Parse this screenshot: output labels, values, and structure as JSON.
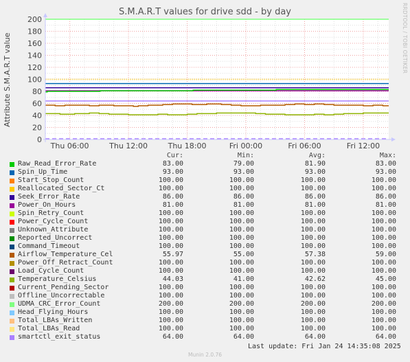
{
  "title": "S.M.A.R.T values for drive sdd - by day",
  "side_credit": "RRDTOOL / TOBI OETIKER",
  "footer": "Munin 2.0.76",
  "last_update": "Last update: Fri Jan 24 14:35:08 2025",
  "legend_headers": {
    "cur": "Cur:",
    "min": "Min:",
    "avg": "Avg:",
    "max": "Max:"
  },
  "chart_data": {
    "type": "line",
    "title": "S.M.A.R.T values for drive sdd - by day",
    "xlabel": "",
    "ylabel": "Attribute S.M.A.R.T value",
    "ylim": [
      0,
      200
    ],
    "yticks": [
      0,
      20,
      40,
      60,
      80,
      100,
      120,
      140,
      160,
      180,
      200
    ],
    "x_range_hours": [
      3.5,
      38.6
    ],
    "xticks": [
      {
        "label": "Thu 06:00",
        "hour": 6
      },
      {
        "label": "Thu 12:00",
        "hour": 12
      },
      {
        "label": "Thu 18:00",
        "hour": 18
      },
      {
        "label": "Fri 00:00",
        "hour": 24
      },
      {
        "label": "Fri 06:00",
        "hour": 30
      },
      {
        "label": "Fri 12:00",
        "hour": 36
      }
    ],
    "grid": true,
    "legend_position": "bottom",
    "series": [
      {
        "name": "Raw_Read_Error_Rate",
        "color": "#00cc00",
        "cur": "83.00",
        "min": "79.00",
        "avg": "81.90",
        "max": "83.00",
        "points": [
          [
            3.5,
            79
          ],
          [
            3.7,
            80
          ],
          [
            9,
            80
          ],
          [
            9.1,
            81
          ],
          [
            18.5,
            81
          ],
          [
            18.6,
            82
          ],
          [
            20.5,
            82
          ],
          [
            20.6,
            82
          ],
          [
            27,
            82
          ],
          [
            27.1,
            83
          ],
          [
            38.6,
            83
          ]
        ]
      },
      {
        "name": "Spin_Up_Time",
        "color": "#0066b3",
        "cur": "93.00",
        "min": "93.00",
        "avg": "93.00",
        "max": "93.00",
        "constant": 93
      },
      {
        "name": "Start_Stop_Count",
        "color": "#ff8000",
        "cur": "100.00",
        "min": "100.00",
        "avg": "100.00",
        "max": "100.00",
        "constant": 100
      },
      {
        "name": "Reallocated_Sector_Ct",
        "color": "#ffcc00",
        "cur": "100.00",
        "min": "100.00",
        "avg": "100.00",
        "max": "100.00",
        "constant": 100
      },
      {
        "name": "Seek_Error_Rate",
        "color": "#330099",
        "cur": "86.00",
        "min": "86.00",
        "avg": "86.00",
        "max": "86.00",
        "constant": 86
      },
      {
        "name": "Power_On_Hours",
        "color": "#990099",
        "cur": "81.00",
        "min": "81.00",
        "avg": "81.00",
        "max": "81.00",
        "constant": 81
      },
      {
        "name": "Spin_Retry_Count",
        "color": "#ccff00",
        "cur": "100.00",
        "min": "100.00",
        "avg": "100.00",
        "max": "100.00",
        "constant": 100
      },
      {
        "name": "Power_Cycle_Count",
        "color": "#ff0000",
        "cur": "100.00",
        "min": "100.00",
        "avg": "100.00",
        "max": "100.00",
        "constant": 100
      },
      {
        "name": "Unknown_Attribute",
        "color": "#808080",
        "cur": "100.00",
        "min": "100.00",
        "avg": "100.00",
        "max": "100.00",
        "constant": 100
      },
      {
        "name": "Reported_Uncorrect",
        "color": "#008f00",
        "cur": "100.00",
        "min": "100.00",
        "avg": "100.00",
        "max": "100.00",
        "constant": 100
      },
      {
        "name": "Command_Timeout",
        "color": "#00487d",
        "cur": "100.00",
        "min": "100.00",
        "avg": "100.00",
        "max": "100.00",
        "constant": 100
      },
      {
        "name": "Airflow_Temperature_Cel",
        "color": "#b35a00",
        "cur": "55.97",
        "min": "55.00",
        "avg": "57.38",
        "max": "59.00",
        "points": [
          [
            3.5,
            57
          ],
          [
            4.5,
            56
          ],
          [
            5.5,
            57
          ],
          [
            7,
            57
          ],
          [
            8,
            56
          ],
          [
            9,
            57
          ],
          [
            10,
            57
          ],
          [
            10.5,
            56
          ],
          [
            12,
            56
          ],
          [
            12.5,
            55
          ],
          [
            13,
            56
          ],
          [
            14,
            57
          ],
          [
            15,
            57
          ],
          [
            15.5,
            58
          ],
          [
            16,
            58
          ],
          [
            16.5,
            59
          ],
          [
            18.5,
            58
          ],
          [
            19.5,
            58
          ],
          [
            20,
            59
          ],
          [
            21.5,
            58
          ],
          [
            22.5,
            57
          ],
          [
            23.5,
            56
          ],
          [
            25,
            56
          ],
          [
            25.5,
            57
          ],
          [
            27,
            57
          ],
          [
            28,
            58
          ],
          [
            29,
            59
          ],
          [
            30,
            58
          ],
          [
            31,
            59
          ],
          [
            32,
            58
          ],
          [
            33,
            57
          ],
          [
            34,
            57
          ],
          [
            35,
            57
          ],
          [
            36,
            56
          ],
          [
            37,
            57
          ],
          [
            38,
            56
          ],
          [
            38.6,
            56
          ]
        ]
      },
      {
        "name": "Power_Off_Retract_Count",
        "color": "#b38f00",
        "cur": "100.00",
        "min": "100.00",
        "avg": "100.00",
        "max": "100.00",
        "constant": 100
      },
      {
        "name": "Load_Cycle_Count",
        "color": "#6b006b",
        "cur": "100.00",
        "min": "100.00",
        "avg": "100.00",
        "max": "100.00",
        "constant": 100
      },
      {
        "name": "Temperature_Celsius",
        "color": "#8fb300",
        "cur": "44.03",
        "min": "41.00",
        "avg": "42.62",
        "max": "45.00",
        "points": [
          [
            3.5,
            43
          ],
          [
            5,
            42
          ],
          [
            6.5,
            43
          ],
          [
            7.5,
            43
          ],
          [
            8,
            44
          ],
          [
            9,
            43
          ],
          [
            10,
            42
          ],
          [
            11,
            42
          ],
          [
            12,
            41
          ],
          [
            14,
            41
          ],
          [
            15,
            42
          ],
          [
            16,
            41
          ],
          [
            18,
            42
          ],
          [
            19,
            43
          ],
          [
            21,
            44
          ],
          [
            24,
            44
          ],
          [
            25,
            43
          ],
          [
            26,
            42
          ],
          [
            27,
            42
          ],
          [
            28,
            41
          ],
          [
            29.5,
            41
          ],
          [
            31,
            42
          ],
          [
            32,
            41
          ],
          [
            33,
            42
          ],
          [
            34,
            43
          ],
          [
            36,
            44
          ],
          [
            38.6,
            44
          ]
        ]
      },
      {
        "name": "Current_Pending_Sector",
        "color": "#b30000",
        "cur": "100.00",
        "min": "100.00",
        "avg": "100.00",
        "max": "100.00",
        "constant": 100
      },
      {
        "name": "Offline_Uncorrectable",
        "color": "#bebebe",
        "cur": "100.00",
        "min": "100.00",
        "avg": "100.00",
        "max": "100.00",
        "constant": 100
      },
      {
        "name": "UDMA_CRC_Error_Count",
        "color": "#80ff80",
        "cur": "200.00",
        "min": "200.00",
        "avg": "200.00",
        "max": "200.00",
        "constant": 200
      },
      {
        "name": "Head_Flying_Hours",
        "color": "#80c9ff",
        "cur": "100.00",
        "min": "100.00",
        "avg": "100.00",
        "max": "100.00",
        "constant": 100
      },
      {
        "name": "Total_LBAs_Written",
        "color": "#ffc080",
        "cur": "100.00",
        "min": "100.00",
        "avg": "100.00",
        "max": "100.00",
        "constant": 100
      },
      {
        "name": "Total_LBAs_Read",
        "color": "#ffe680",
        "cur": "100.00",
        "min": "100.00",
        "avg": "100.00",
        "max": "100.00",
        "constant": 100
      },
      {
        "name": "smartctl_exit_status",
        "color": "#aa80ff",
        "cur": "64.00",
        "min": "64.00",
        "avg": "64.00",
        "max": "64.00",
        "constant": 64
      }
    ],
    "extra_lines": [
      {
        "name": "zero-dashed-line",
        "color": "#aa80ff",
        "value": 0,
        "dashed": true
      }
    ]
  }
}
